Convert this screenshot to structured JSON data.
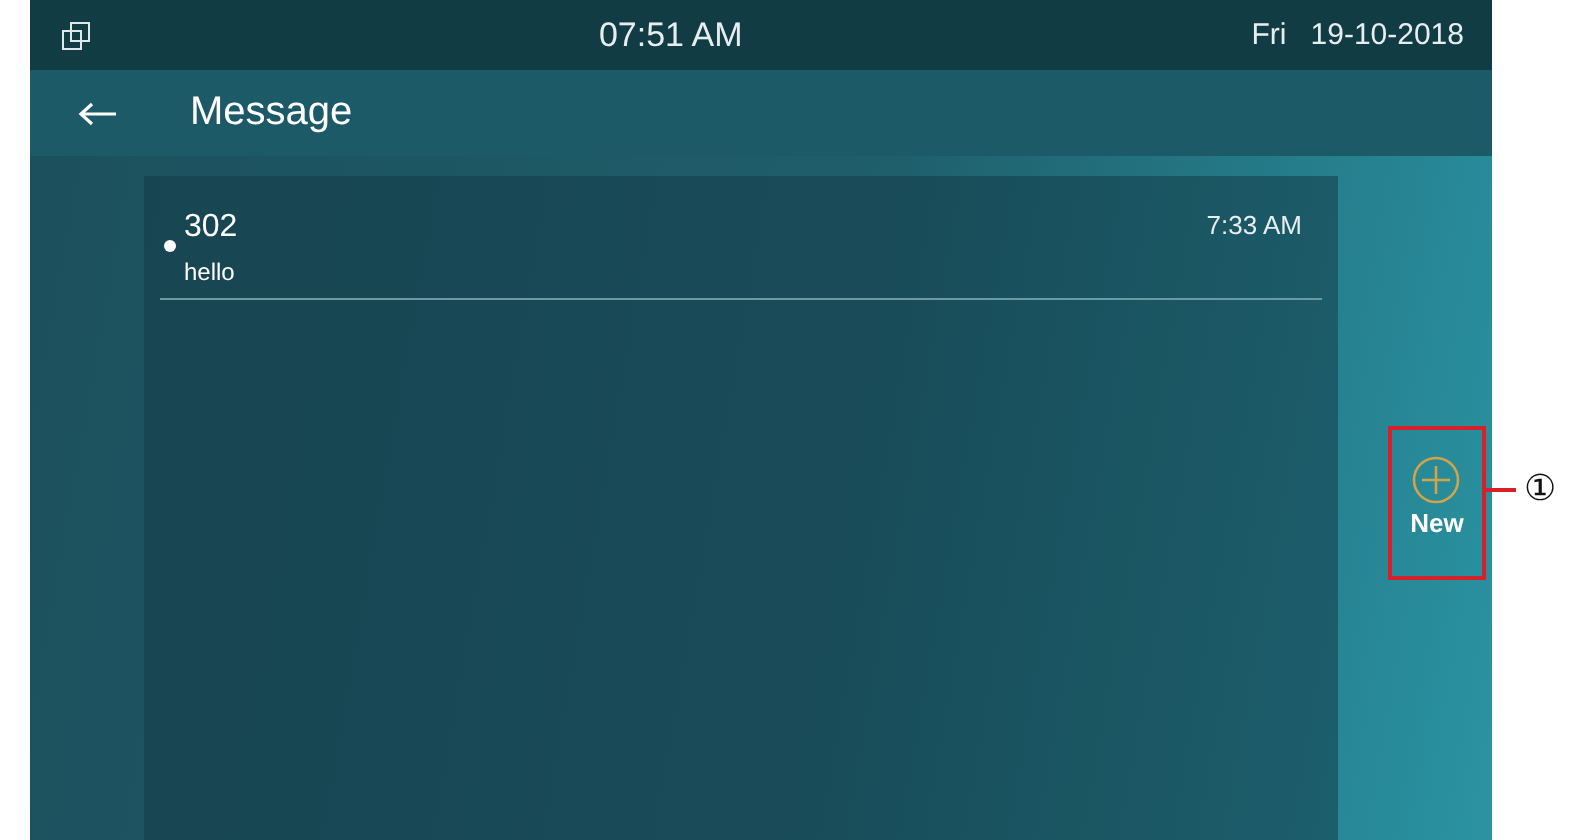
{
  "status_bar": {
    "time": "07:51 AM",
    "day": "Fri",
    "date": "19-10-2018"
  },
  "header": {
    "title": "Message"
  },
  "messages": [
    {
      "sender": "302",
      "text": "hello",
      "time": "7:33 AM",
      "unread": true
    }
  ],
  "new_button": {
    "label": "New"
  },
  "callout": {
    "label": "①"
  }
}
